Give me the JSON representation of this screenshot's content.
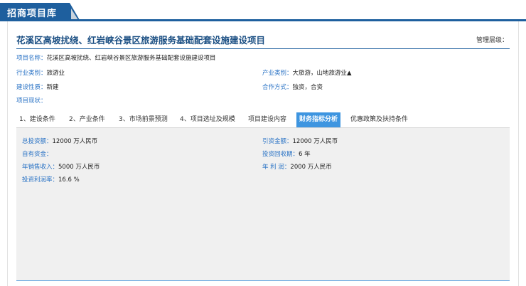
{
  "header": {
    "title": "招商项目库"
  },
  "project": {
    "title": "花溪区高坡扰绕、红岩峡谷景区旅游服务基础配套设施建设项目",
    "mgmt_level_label": "管理层级："
  },
  "info": {
    "name_label": "项目名称：",
    "name_value": "花溪区高坡扰绕、红岩峡谷景区旅游服务基础配套设施建设项目",
    "industry_category_label": "行业类别：",
    "industry_category_value": "旅游业",
    "industry_type_label": "产业类别：",
    "industry_type_value": "大旅游，山地旅游业▲",
    "construction_label": "建设性质：",
    "construction_value": "新建",
    "cooperation_label": "合作方式：",
    "cooperation_value": "独资，合资",
    "status_label": "项目现状："
  },
  "tabs": [
    {
      "label": "1、建设条件"
    },
    {
      "label": "2、产业条件"
    },
    {
      "label": "3、市场前景预测"
    },
    {
      "label": "4、项目选址及规模"
    },
    {
      "label": "项目建设内容"
    },
    {
      "label": "财务指标分析"
    },
    {
      "label": "优惠政策及扶持条件"
    }
  ],
  "active_tab": "财务指标分析",
  "finance": {
    "total_investment_label": "总投资额：",
    "total_investment_value": "12000 万人民币",
    "attract_amount_label": "引资金额：",
    "attract_amount_value": "12000 万人民币",
    "own_funds_label": "自有资金：",
    "payback_label": "投资回收期：",
    "payback_value": "6 年",
    "annual_sales_label": "年销售收入：",
    "annual_sales_value": "5000 万人民币",
    "annual_profit_label": "年 利 润：",
    "annual_profit_value": "2000 万人民币",
    "roi_label": "投资利润率：",
    "roi_value": "16.6 %"
  },
  "colors": {
    "brand": "#1e5f9e",
    "active_tab": "#3e95e0",
    "label_blue": "#2a73c5",
    "content_bg": "#f0f0f0"
  }
}
